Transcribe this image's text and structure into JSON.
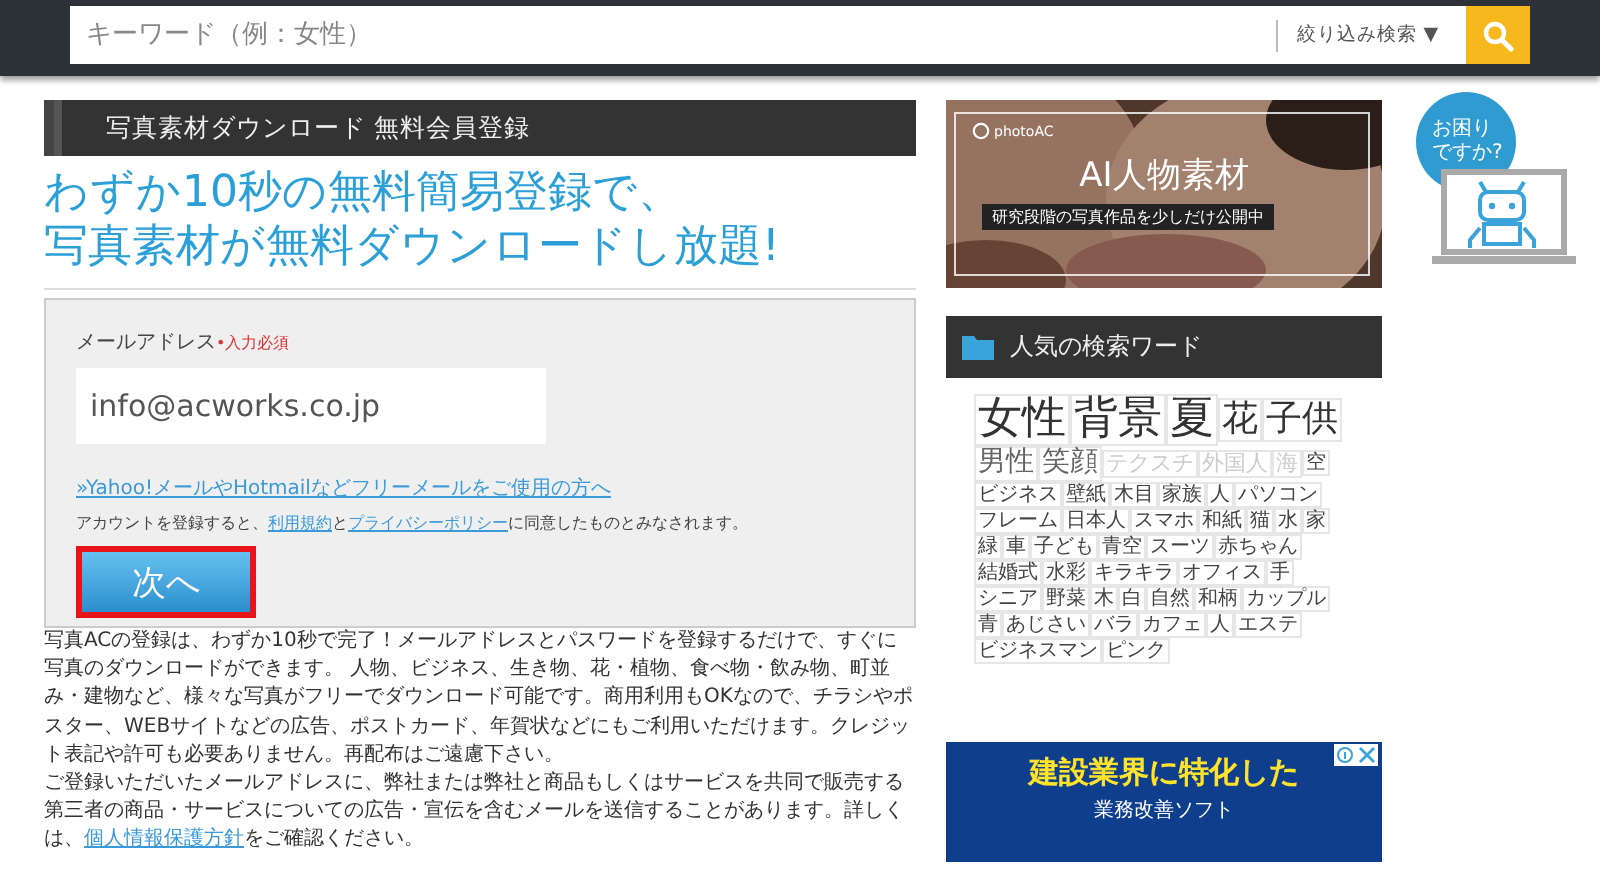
{
  "search": {
    "placeholder": "キーワード（例：女性）",
    "filter_label": "絞り込み検索",
    "filter_caret": "▼"
  },
  "registration": {
    "header": "写真素材ダウンロード 無料会員登録",
    "headline": [
      "わずか10秒の無料簡易登録で、",
      "写真素材が無料ダウンロードし放題!"
    ],
    "email_label": "メールアドレス",
    "required": "•入力必須",
    "email_value": "info@acworks.co.jp",
    "free_mail_link": "»Yahoo!メールやHotmailなどフリーメールをご使用の方へ",
    "terms": [
      {
        "text": "アカウントを登録すると、",
        "link": false
      },
      {
        "text": "利用規約",
        "link": true
      },
      {
        "text": "と",
        "link": false
      },
      {
        "text": "プライバシーポリシー",
        "link": true
      },
      {
        "text": "に同意したものとみなされます。",
        "link": false
      }
    ],
    "next_button": "次へ",
    "next_highlighted": true
  },
  "description": [
    [
      {
        "text": "写真ACの登録は、わずか10秒で完了！メールアドレスとパスワードを登録するだけで、すぐに写真のダウンロードができます。 人物、ビジネス、生き物、花・植物、食べ物・飲み物、町並み・建物など、様々な写真がフリーでダウンロード可能です。商用利用もOKなので、チラシやポスター、WEBサイトなどの広告、ポストカード、年賀状などにもご利用いただけます。クレジット表記や許可も必要ありません。再配布はご遠慮下さい。",
        "link": false
      }
    ],
    [
      {
        "text": "ご登録いただいたメールアドレスに、弊社または弊社と商品もしくはサービスを共同で販売する第三者の商品・サービスについての広告・宣伝を含むメールを送信することがあります。詳しくは、",
        "link": false
      },
      {
        "text": "個人情報保護方針",
        "link": true
      },
      {
        "text": "をご確認ください。",
        "link": false
      }
    ]
  ],
  "ad": {
    "kind": "picture",
    "brand": "photoAC",
    "title": "AI人物素材",
    "subtitle": "研究段階の写真作品を少しだけ公開中"
  },
  "help": {
    "bubble": [
      "お困り",
      "ですか?"
    ]
  },
  "popular": {
    "title": "人気の検索ワード",
    "words": [
      {
        "text": "女性",
        "kind": "xl"
      },
      {
        "text": "背景",
        "kind": "xl"
      },
      {
        "text": "夏",
        "kind": "xl"
      },
      {
        "text": "花",
        "kind": "l"
      },
      {
        "text": "子供",
        "kind": "l"
      },
      {
        "text": "男性",
        "kind": "m"
      },
      {
        "text": "笑顔",
        "kind": "m"
      },
      {
        "text": "テクスチ",
        "kind": "faded"
      },
      {
        "text": "外国人",
        "kind": "faded"
      },
      {
        "text": "海",
        "kind": "faded"
      },
      {
        "text": "空",
        "kind": "s"
      },
      {
        "text": "ビジネス",
        "kind": "s"
      },
      {
        "text": "壁紙",
        "kind": "s"
      },
      {
        "text": "木目",
        "kind": "s"
      },
      {
        "text": "家族",
        "kind": "s"
      },
      {
        "text": "人",
        "kind": "s"
      },
      {
        "text": "パソコン",
        "kind": "s"
      },
      {
        "text": "フレーム",
        "kind": "s"
      },
      {
        "text": "日本人",
        "kind": "s"
      },
      {
        "text": "スマホ",
        "kind": "s"
      },
      {
        "text": "和紙",
        "kind": "s"
      },
      {
        "text": "猫",
        "kind": "s"
      },
      {
        "text": "水",
        "kind": "s"
      },
      {
        "text": "家",
        "kind": "s"
      },
      {
        "text": "緑",
        "kind": "s"
      },
      {
        "text": "車",
        "kind": "s"
      },
      {
        "text": "子ども",
        "kind": "s"
      },
      {
        "text": "青空",
        "kind": "s"
      },
      {
        "text": "スーツ",
        "kind": "s"
      },
      {
        "text": "赤ちゃん",
        "kind": "s"
      },
      {
        "text": "結婚式",
        "kind": "s"
      },
      {
        "text": "水彩",
        "kind": "s"
      },
      {
        "text": "キラキラ",
        "kind": "s"
      },
      {
        "text": "オフィス",
        "kind": "s"
      },
      {
        "text": "手",
        "kind": "s"
      },
      {
        "text": "シニア",
        "kind": "s"
      },
      {
        "text": "野菜",
        "kind": "s"
      },
      {
        "text": "木",
        "kind": "s"
      },
      {
        "text": "白",
        "kind": "s"
      },
      {
        "text": "自然",
        "kind": "s"
      },
      {
        "text": "和柄",
        "kind": "s"
      },
      {
        "text": "カップル",
        "kind": "s"
      },
      {
        "text": "青",
        "kind": "s"
      },
      {
        "text": "あじさい",
        "kind": "s"
      },
      {
        "text": "バラ",
        "kind": "s"
      },
      {
        "text": "カフェ",
        "kind": "s"
      },
      {
        "text": "人",
        "kind": "s"
      },
      {
        "text": "エステ",
        "kind": "s"
      },
      {
        "text": "ビジネスマン",
        "kind": "s"
      },
      {
        "text": "ピンク",
        "kind": "s"
      }
    ]
  },
  "bottom_ad": {
    "headline": "建設業界に特化した",
    "sub": "業務改善ソフト"
  }
}
